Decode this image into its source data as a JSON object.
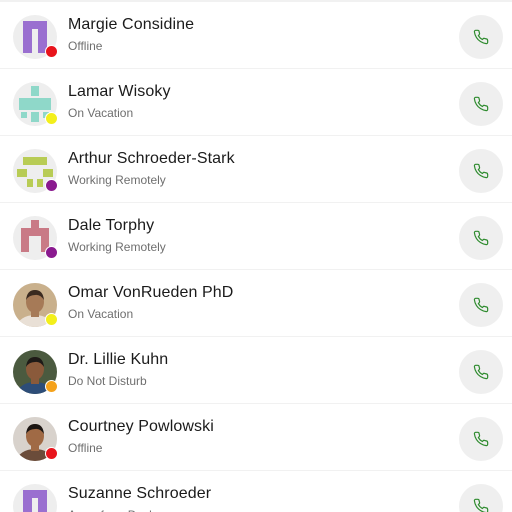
{
  "contacts": [
    {
      "name": "Margie Considine",
      "status": "Offline",
      "status_color": "#e8141c",
      "avatar": {
        "kind": "pattern",
        "color": "#9a6fd0",
        "pattern": "margie"
      }
    },
    {
      "name": "Lamar Wisoky",
      "status": "On Vacation",
      "status_color": "#f3ef1b",
      "avatar": {
        "kind": "pattern",
        "color": "#8fd8c9",
        "pattern": "lamar"
      }
    },
    {
      "name": "Arthur Schroeder-Stark",
      "status": "Working Remotely",
      "status_color": "#8a1a8f",
      "avatar": {
        "kind": "pattern",
        "color": "#b8cc55",
        "pattern": "arthur"
      }
    },
    {
      "name": "Dale Torphy",
      "status": "Working Remotely",
      "status_color": "#8a1a8f",
      "avatar": {
        "kind": "pattern",
        "color": "#c97a86",
        "pattern": "dale"
      }
    },
    {
      "name": "Omar VonRueden PhD",
      "status": "On Vacation",
      "status_color": "#f3ef1b",
      "avatar": {
        "kind": "photo",
        "bg": "#c9b08c",
        "skin": "#a67a57",
        "hair": "#3a2a20",
        "shirt": "#e9e0d6"
      }
    },
    {
      "name": "Dr. Lillie Kuhn",
      "status": "Do Not Disturb",
      "status_color": "#f5a21b",
      "avatar": {
        "kind": "photo",
        "bg": "#4b5a3f",
        "skin": "#8a5a3b",
        "hair": "#1e1a17",
        "shirt": "#2d4d78"
      }
    },
    {
      "name": "Courtney Powlowski",
      "status": "Offline",
      "status_color": "#e8141c",
      "avatar": {
        "kind": "photo",
        "bg": "#d8d2cc",
        "skin": "#a06a45",
        "hair": "#1b1512",
        "shirt": "#6b4c3a"
      }
    },
    {
      "name": "Suzanne Schroeder",
      "status": "Away from Desk",
      "status_color": "#e8141c",
      "avatar": {
        "kind": "pattern",
        "color": "#9a6fd0",
        "pattern": "suzanne"
      }
    }
  ],
  "call_icon": "phone-icon",
  "call_icon_color": "#2e8b2e"
}
